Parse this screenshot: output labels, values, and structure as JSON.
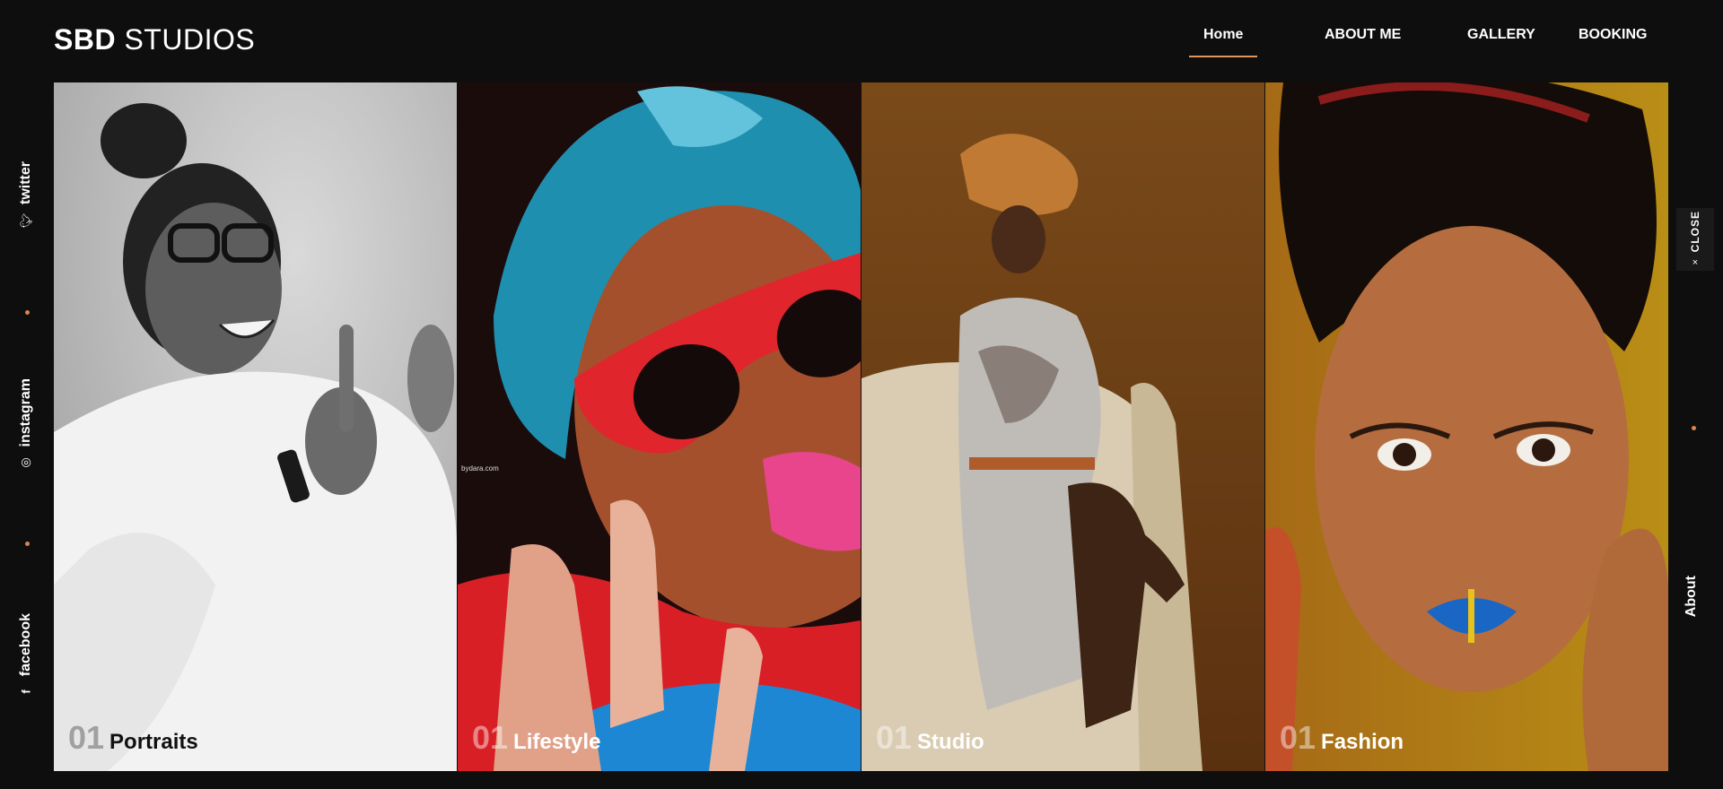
{
  "header": {
    "logo_bold": "SBD",
    "logo_light": "STUDIOS",
    "nav": [
      "Home",
      "ABOUT ME",
      "GALLERY",
      "BOOKING"
    ],
    "active": "Home"
  },
  "social": {
    "twitter": "twitter",
    "instagram": "instagram",
    "facebook": "facebook"
  },
  "right_rail": {
    "close_label": "CLOSE",
    "close_icon": "×",
    "about_label": "About"
  },
  "panels": [
    {
      "num": "01",
      "title": "Portraits"
    },
    {
      "num": "01",
      "title": "Lifestyle"
    },
    {
      "num": "01",
      "title": "Studio"
    },
    {
      "num": "01",
      "title": "Fashion"
    }
  ],
  "watermark": "bydara.com",
  "colors": {
    "background": "#0e0e0e",
    "accent": "#e0955b"
  }
}
